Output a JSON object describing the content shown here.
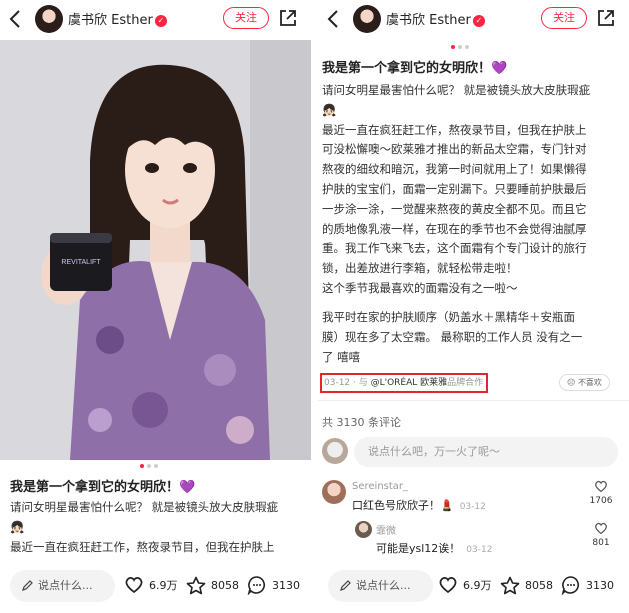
{
  "header": {
    "username": "虞书欣 Esther",
    "verified_mark": "✓",
    "follow_label": "关注"
  },
  "post": {
    "title": "我是第一个拿到它的女明欣！💜",
    "left_lines": [
      "请问女明星最害怕什么呢？ 就是被镜头放大皮肤瑕疵",
      "👧🏻",
      "最近一直在疯狂赶工作，熬夜录节目，但我在护肤上"
    ],
    "right_lines_1": [
      "请问女明星最害怕什么呢？ 就是被镜头放大皮肤瑕疵",
      "👧🏻",
      "最近一直在疯狂赶工作，熬夜录节目，但我在护肤上",
      "可没松懈噢～欧莱雅才推出的新品太空霜，专门针对",
      "熬夜的细纹和暗沉，我第一时间就用上了！如果懒得",
      "护肤的宝宝们，面霜一定别漏下。只要睡前护肤最后",
      "一步涂一涂，一觉醒来熬夜的黄皮全都不见。而且它",
      "的质地像乳液一样，在现在的季节也不会觉得油腻厚",
      "重。我工作飞来飞去，这个面霜有个专门设计的旅行",
      "锁，出差放进行李箱，就轻松带走啦！",
      "这个季节我最喜欢的面霜没有之一啦～"
    ],
    "right_lines_2": [
      "我平时在家的护肤顺序（奶盖水＋黑精华＋安瓶面",
      "膜）现在多了太空霜。 最称职的工作人员 没有之一",
      "了 嘻嘻"
    ],
    "meta_date": "03-12 · 与 ",
    "meta_brand": "@L'ORÉAL 欧莱雅",
    "meta_suffix": "品牌合作",
    "dislike_label": "不喜欢",
    "product_label": "REVITALIFT"
  },
  "comments": {
    "count_label": "共 3130 条评论",
    "input_placeholder": "说点什么吧，万一火了呢～",
    "items": [
      {
        "author": "Sereinstar_",
        "text": "口红色号欣欣子！💄",
        "time": "03-12",
        "likes": "1706"
      },
      {
        "author": "霏微",
        "text": "可能是ysl12诶！",
        "time": "03-12",
        "likes": "801"
      }
    ]
  },
  "bottom": {
    "input_placeholder": "说点什么...",
    "likes": "6.9万",
    "collects": "8058",
    "comments": "3130"
  },
  "colors": {
    "accent": "#ff2442",
    "highlight_box": "#e0262a"
  }
}
